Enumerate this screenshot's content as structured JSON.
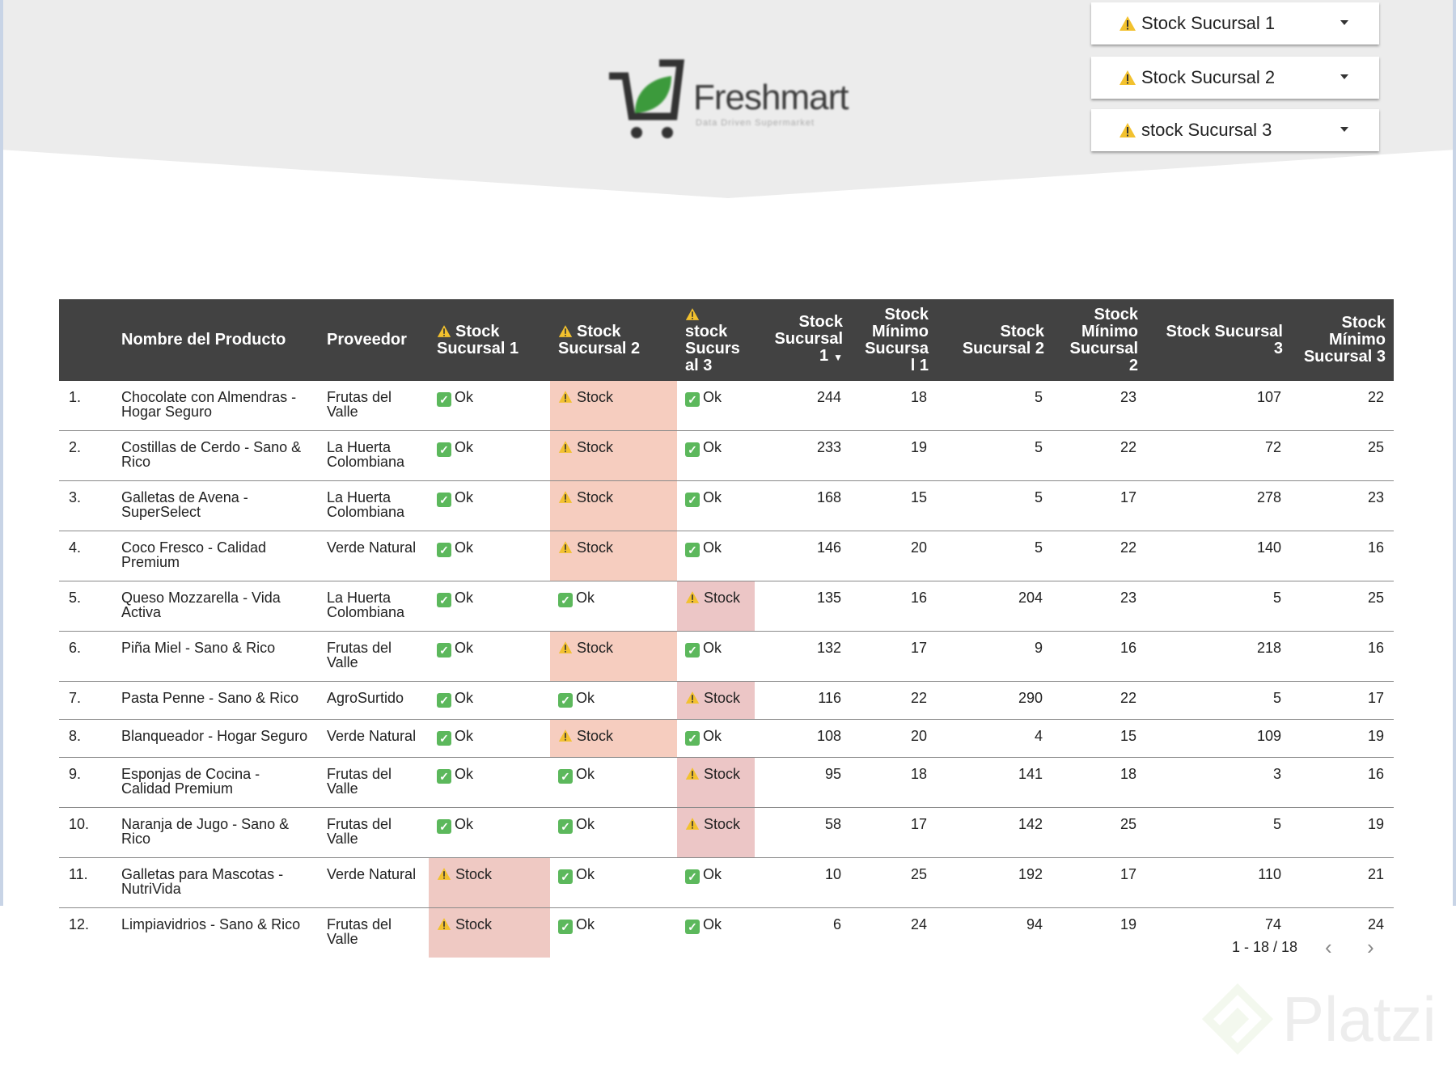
{
  "brand": {
    "name": "Freshmart",
    "tagline": "Data Driven Supermarket",
    "watermark": "Platzi"
  },
  "filters": [
    {
      "label": "Stock Sucursal 1"
    },
    {
      "label": "Stock Sucursal 2"
    },
    {
      "label": "stock Sucursal 3"
    }
  ],
  "table": {
    "headers": [
      "",
      "Nombre del Producto",
      "Proveedor",
      "Stock Sucursal 1",
      "Stock Sucursal 2",
      "stock Sucurs al 3",
      "Stock Sucursal 1",
      "Stock Mínimo Sucursa l 1",
      "Stock Sucursal 2",
      "Stock Mínimo Sucursal 2",
      "Stock Sucursal 3",
      "Stock Mínimo Sucursal 3"
    ],
    "sort_indicator": "▼",
    "rows": [
      {
        "idx": "1.",
        "name": "Chocolate con Almendras - Hogar Seguro",
        "prov": "Frutas del Valle",
        "s1": "Ok",
        "s2": "Stock",
        "s3": "Ok",
        "v": [
          244,
          18,
          5,
          23,
          107,
          22
        ]
      },
      {
        "idx": "2.",
        "name": "Costillas de Cerdo - Sano & Rico",
        "prov": "La Huerta Colombiana",
        "s1": "Ok",
        "s2": "Stock",
        "s3": "Ok",
        "v": [
          233,
          19,
          5,
          22,
          72,
          25
        ]
      },
      {
        "idx": "3.",
        "name": "Galletas de Avena - SuperSelect",
        "prov": "La Huerta Colombiana",
        "s1": "Ok",
        "s2": "Stock",
        "s3": "Ok",
        "v": [
          168,
          15,
          5,
          17,
          278,
          23
        ]
      },
      {
        "idx": "4.",
        "name": "Coco Fresco - Calidad Premium",
        "prov": "Verde Natural",
        "s1": "Ok",
        "s2": "Stock",
        "s3": "Ok",
        "v": [
          146,
          20,
          5,
          22,
          140,
          16
        ]
      },
      {
        "idx": "5.",
        "name": "Queso Mozzarella - Vida Activa",
        "prov": "La Huerta Colombiana",
        "s1": "Ok",
        "s2": "Ok",
        "s3": "Stock",
        "v": [
          135,
          16,
          204,
          23,
          5,
          25
        ]
      },
      {
        "idx": "6.",
        "name": "Piña Miel - Sano & Rico",
        "prov": "Frutas del Valle",
        "s1": "Ok",
        "s2": "Stock",
        "s3": "Ok",
        "v": [
          132,
          17,
          9,
          16,
          218,
          16
        ]
      },
      {
        "idx": "7.",
        "name": "Pasta Penne - Sano & Rico",
        "prov": "AgroSurtido",
        "s1": "Ok",
        "s2": "Ok",
        "s3": "Stock",
        "v": [
          116,
          22,
          290,
          22,
          5,
          17
        ]
      },
      {
        "idx": "8.",
        "name": "Blanqueador - Hogar Seguro",
        "prov": "Verde Natural",
        "s1": "Ok",
        "s2": "Stock",
        "s3": "Ok",
        "v": [
          108,
          20,
          4,
          15,
          109,
          19
        ]
      },
      {
        "idx": "9.",
        "name": "Esponjas de Cocina - Calidad Premium",
        "prov": "Frutas del Valle",
        "s1": "Ok",
        "s2": "Ok",
        "s3": "Stock",
        "v": [
          95,
          18,
          141,
          18,
          3,
          16
        ]
      },
      {
        "idx": "10.",
        "name": "Naranja de Jugo - Sano & Rico",
        "prov": "Frutas del Valle",
        "s1": "Ok",
        "s2": "Ok",
        "s3": "Stock",
        "v": [
          58,
          17,
          142,
          25,
          5,
          19
        ]
      },
      {
        "idx": "11.",
        "name": "Galletas para Mascotas - NutriVida",
        "prov": "Verde Natural",
        "s1": "Stock",
        "s2": "Ok",
        "s3": "Ok",
        "v": [
          10,
          25,
          192,
          17,
          110,
          21
        ]
      },
      {
        "idx": "12.",
        "name": "Limpiavidrios - Sano & Rico",
        "prov": "Frutas del Valle",
        "s1": "Stock",
        "s2": "Ok",
        "s3": "Ok",
        "v": [
          6,
          24,
          94,
          19,
          74,
          24
        ]
      }
    ]
  },
  "pagination": {
    "label": "1 - 18 / 18",
    "prev": "‹",
    "next": "›"
  },
  "colors": {
    "header_bg": "#424242",
    "alert_s1": "#efc9c3",
    "alert_s2": "#f6cdbf",
    "alert_s3": "#ecc6c6",
    "ok_green": "#5cb85c",
    "warn_yellow": "#f2c12e"
  }
}
